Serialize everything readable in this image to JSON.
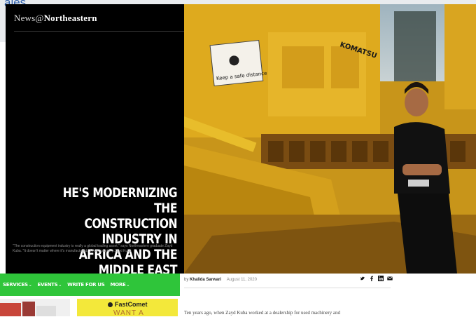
{
  "background": {
    "link_text": "ales",
    "right_text": "▭ ▭ ▭"
  },
  "header": {
    "brand_prefix": "News@",
    "brand_name": "Northeastern"
  },
  "hero": {
    "headline_lines": [
      "HE'S MODERNIZING THE",
      "CONSTRUCTION INDUSTRY IN",
      "AFRICA AND THE MIDDLE EAST"
    ],
    "caption": "\"The construction equipment industry is really a global trading asset,\" says Northeastern graduate Zayd Kuba. \"It doesn't matter where it's manufactured.\" Photo courtesy Zayd Kuba",
    "sign_text": "Keep a safe distance",
    "machine_brand": "KOMATSU"
  },
  "byline": {
    "prefix": "by",
    "author": "Khalida Sarwari",
    "date": "August 11, 2020"
  },
  "share_icons": [
    "twitter-icon",
    "facebook-icon",
    "linkedin-icon",
    "email-icon"
  ],
  "body_text": "Ten years ago, when Zayd Kuba worked at a dealership for used machinery and",
  "overlay_nav": {
    "items": [
      {
        "label": "SERVICES"
      },
      {
        "label": "EVENTS"
      },
      {
        "label": "WRITE FOR US"
      },
      {
        "label": "MORE"
      }
    ],
    "chevron": "⌄"
  },
  "ad": {
    "brand": "FastComet",
    "tagline": "WANT A"
  },
  "colors": {
    "nav_green": "#2fc53a",
    "ad_yellow": "#f3e83a",
    "machine_yellow": "#e0b21f"
  }
}
